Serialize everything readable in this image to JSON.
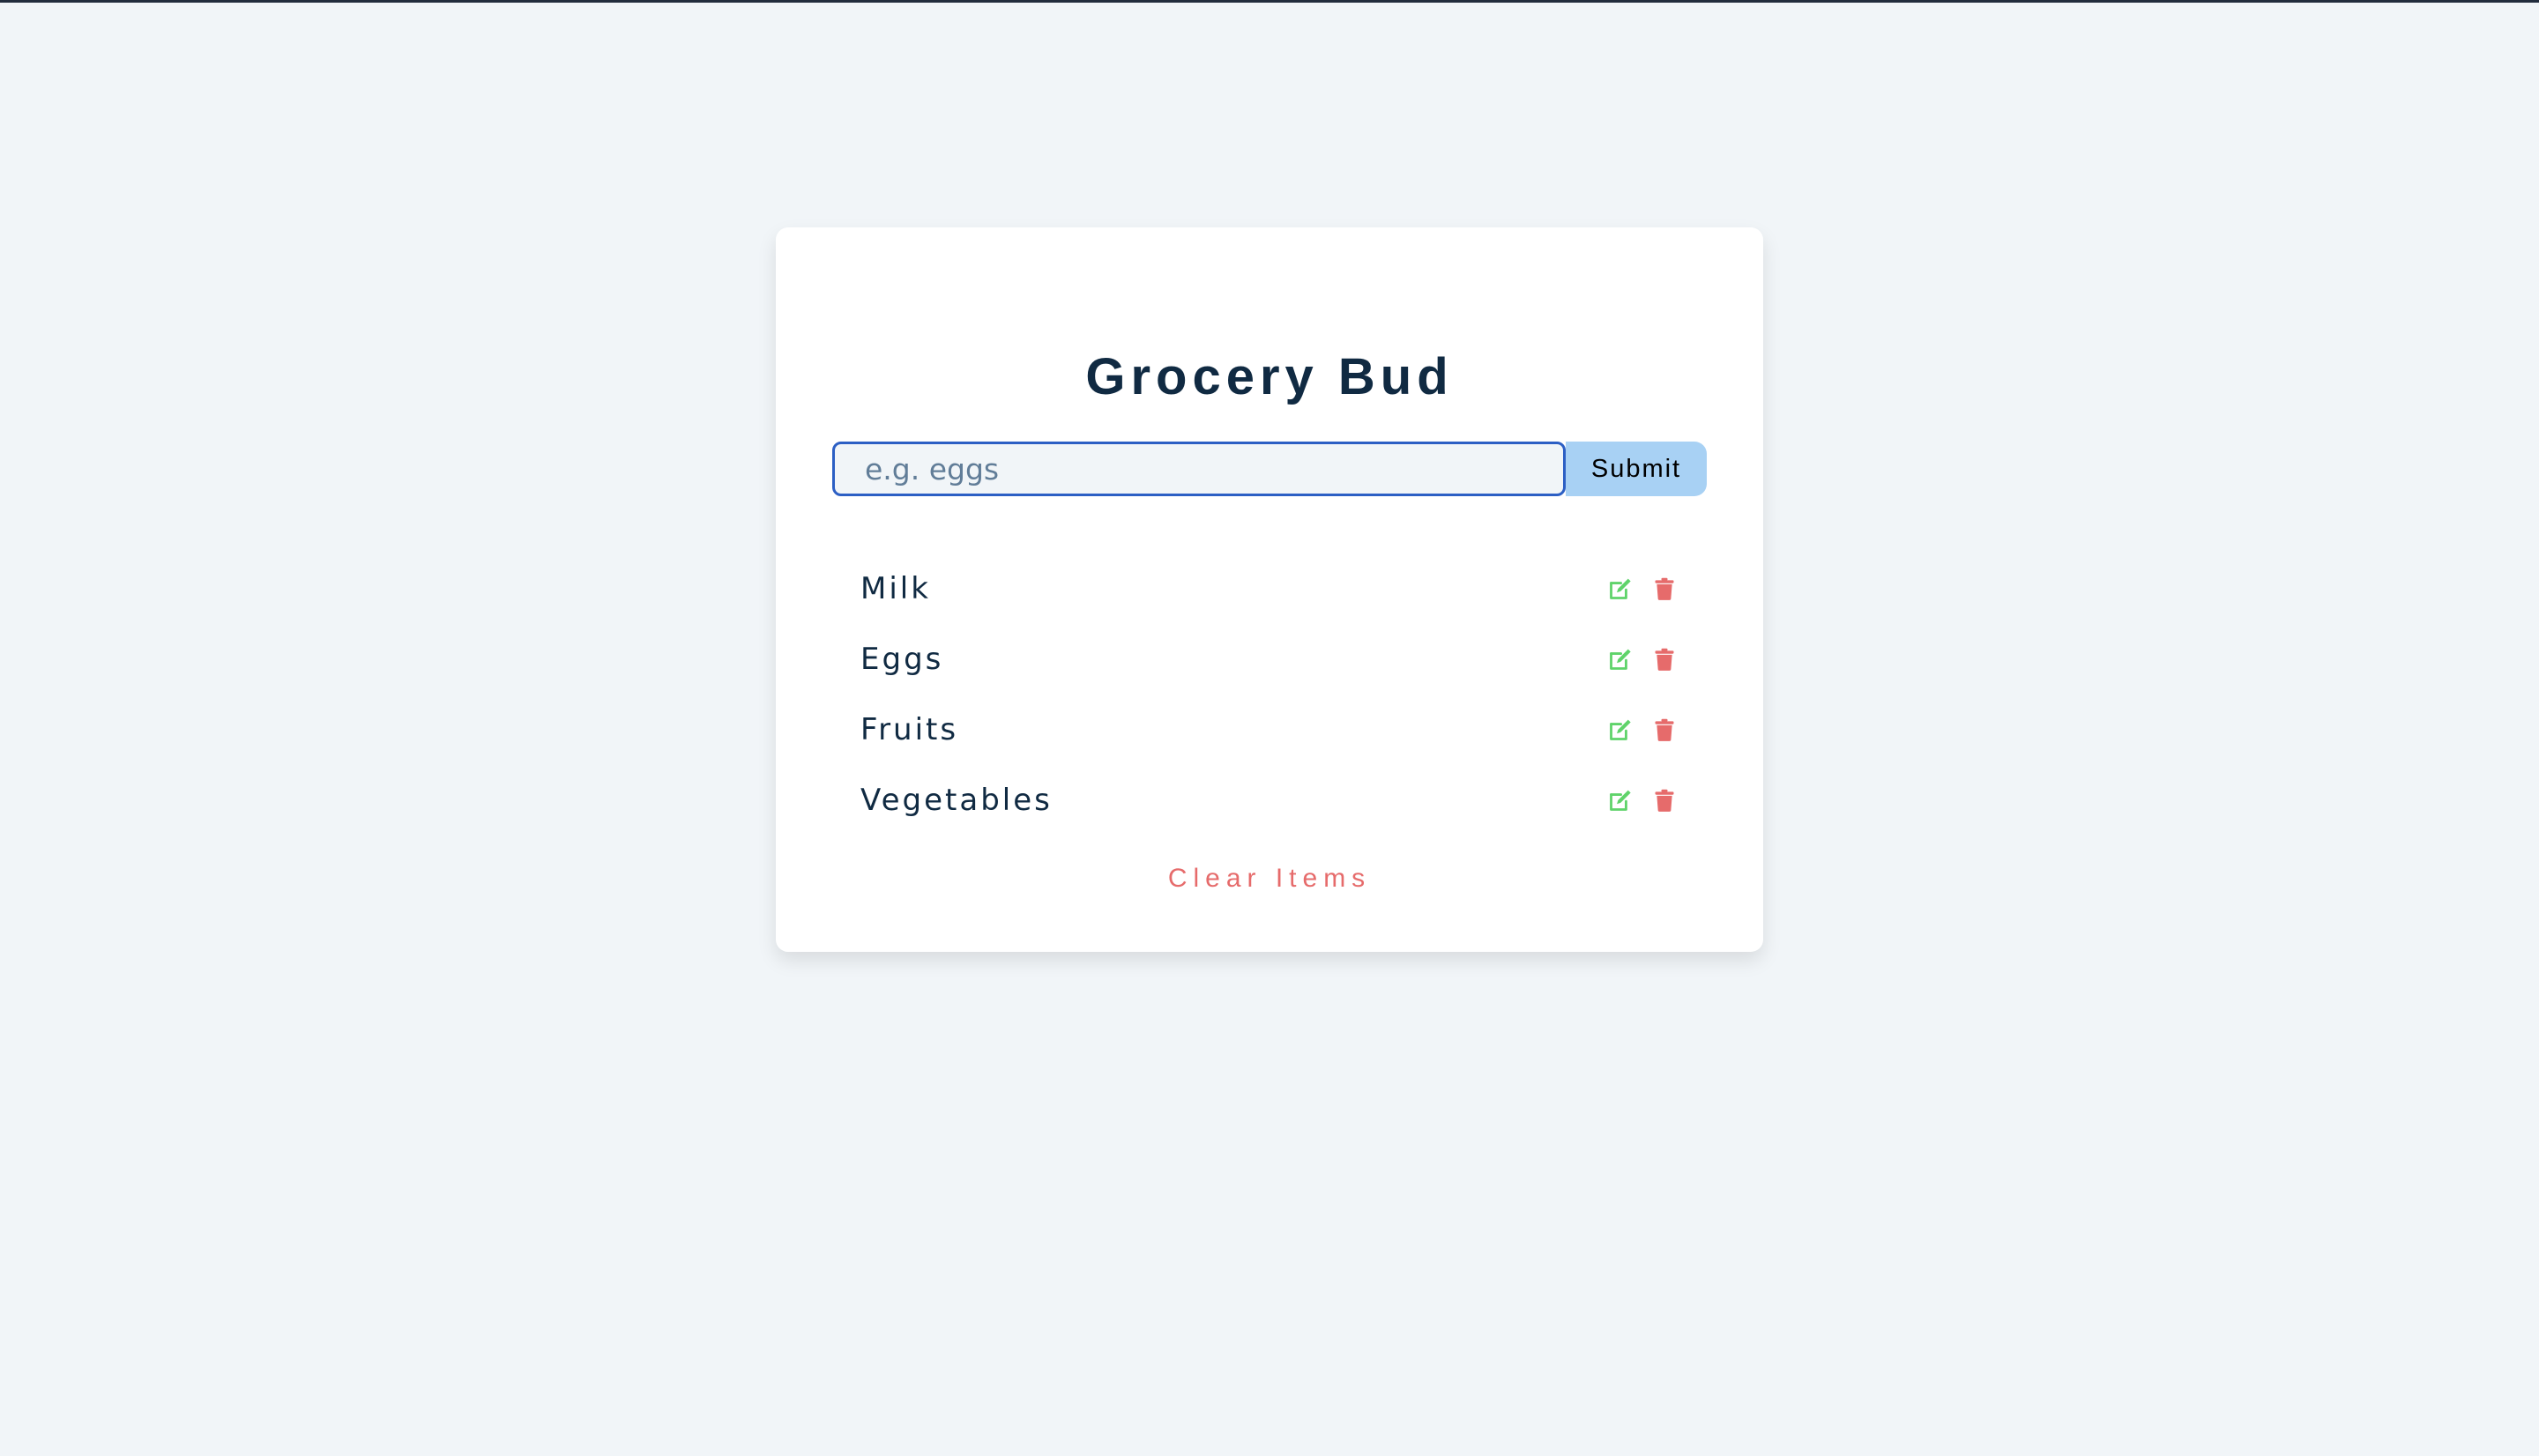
{
  "app": {
    "title": "Grocery Bud"
  },
  "form": {
    "input_value": "",
    "input_placeholder": "e.g. eggs",
    "submit_label": "Submit"
  },
  "items": [
    {
      "title": "Milk",
      "edit_icon": "edit-icon",
      "delete_icon": "trash-icon"
    },
    {
      "title": "Eggs",
      "edit_icon": "edit-icon",
      "delete_icon": "trash-icon"
    },
    {
      "title": "Fruits",
      "edit_icon": "edit-icon",
      "delete_icon": "trash-icon"
    },
    {
      "title": "Vegetables",
      "edit_icon": "edit-icon",
      "delete_icon": "trash-icon"
    }
  ],
  "clear_label": "Clear Items",
  "colors": {
    "background": "#f1f5f8",
    "title": "#102a42",
    "input_border": "#2c5fc4",
    "submit_bg": "#a8d1f4",
    "edit_icon": "#5fd36a",
    "delete_icon": "#e66b6b",
    "clear_text": "#e66b6b"
  }
}
